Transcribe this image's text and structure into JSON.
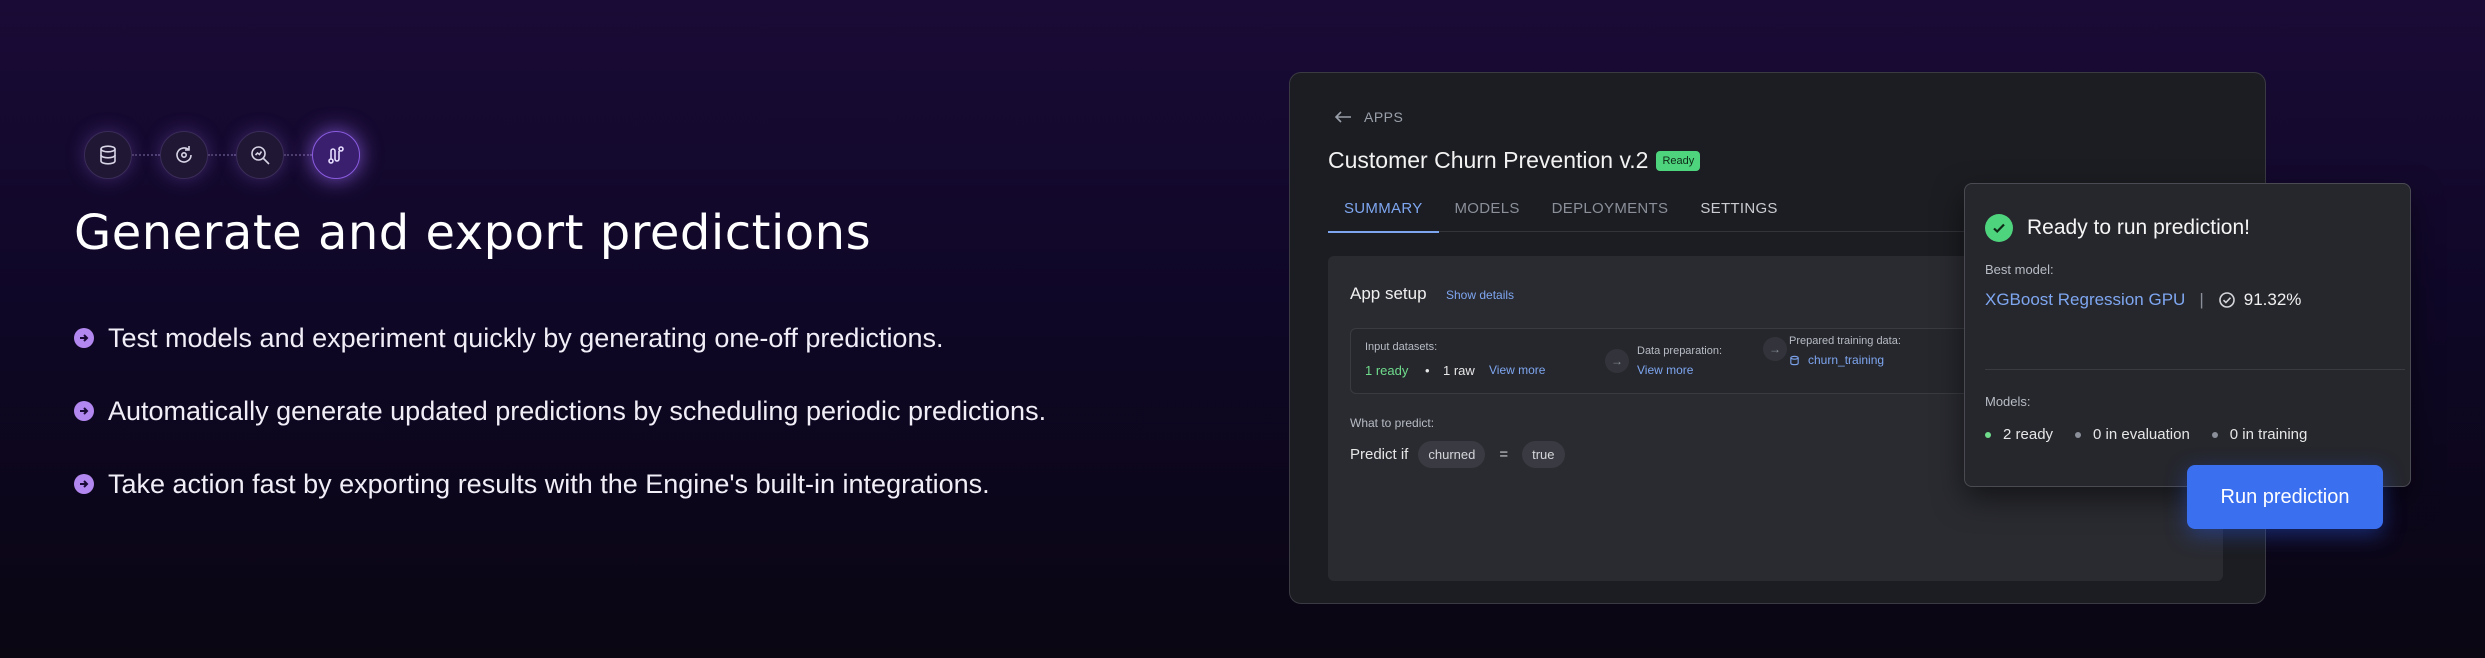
{
  "hero": {
    "headline": "Generate and export predictions",
    "steps": [
      "database-icon",
      "refresh-cycle-icon",
      "search-analytics-icon",
      "deploy-route-icon"
    ],
    "bullets": [
      "Test models and experiment quickly by generating one-off predictions.",
      "Automatically generate updated predictions by scheduling periodic predictions.",
      "Take action fast by exporting results with the Engine's built-in integrations."
    ]
  },
  "app": {
    "back_label": "APPS",
    "title": "Customer Churn Prevention v.2",
    "status_badge": "Ready",
    "tabs": [
      "SUMMARY",
      "MODELS",
      "DEPLOYMENTS",
      "SETTINGS"
    ],
    "setup": {
      "title": "App setup",
      "show_details": "Show details",
      "input_datasets_label": "Input datasets:",
      "ready_count": "1 ready",
      "bullet_sep": "•",
      "raw_count": "1 raw",
      "view_more_1": "View more",
      "data_prep_label": "Data preparation:",
      "view_more_2": "View more",
      "prepared_label": "Prepared training data:",
      "prepared_value": "churn_training",
      "what_label": "What to predict:",
      "predict_if": "Predict if",
      "field": "churned",
      "operator": "=",
      "value": "true"
    }
  },
  "popup": {
    "title": "Ready to run prediction!",
    "best_model_label": "Best model:",
    "best_model": "XGBoost Regression GPU",
    "separator": "|",
    "score": "91.32%",
    "models_label": "Models:",
    "models": [
      "2 ready",
      "0 in evaluation",
      "0 in training"
    ],
    "run_button": "Run prediction"
  },
  "colors": {
    "accent_blue": "#3a6ff0",
    "link_blue": "#7ea6f0",
    "success_green": "#4fd47e",
    "bullet_purple": "#b387f0"
  }
}
